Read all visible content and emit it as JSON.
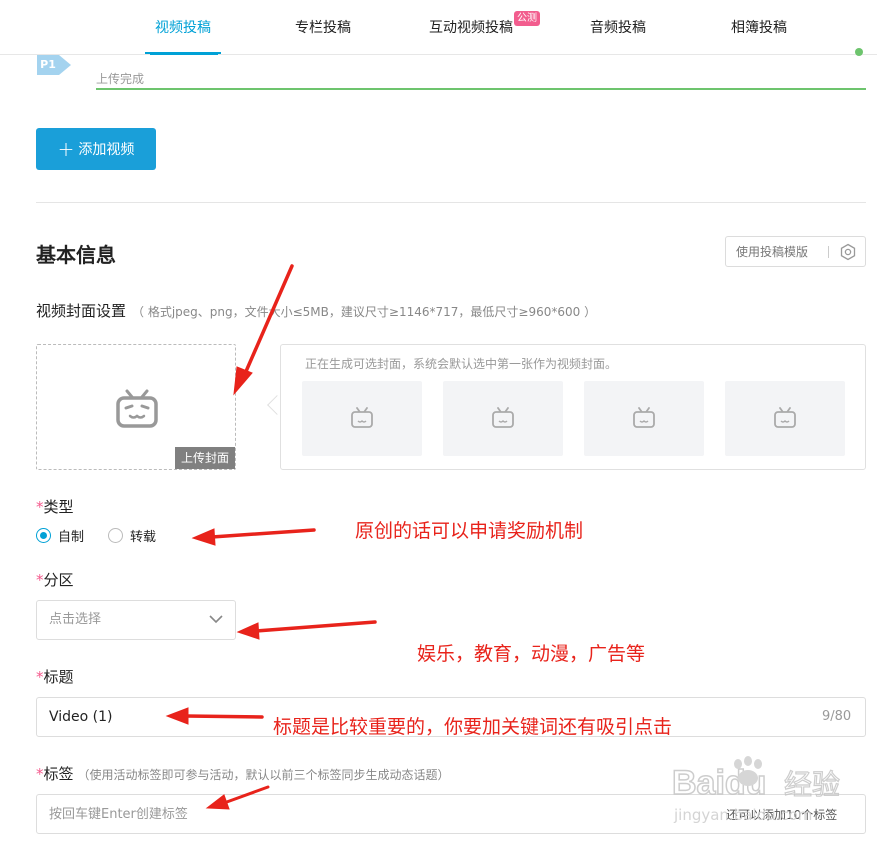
{
  "tabs": [
    {
      "label": "视频投稿",
      "active": true
    },
    {
      "label": "专栏投稿",
      "active": false
    },
    {
      "label": "互动视频投稿",
      "active": false,
      "badge": "公测"
    },
    {
      "label": "音频投稿",
      "active": false
    },
    {
      "label": "相簿投稿",
      "active": false
    }
  ],
  "upload": {
    "part_label": "P1",
    "status_text": "上传完成",
    "progress": 1.0
  },
  "add_video_label": "添加视频",
  "basic_info": {
    "title": "基本信息",
    "template_button": "使用投稿模版"
  },
  "cover": {
    "label": "视频封面设置",
    "hint": "（ 格式jpeg、png，文件大小≤5MB，建议尺寸≥1146*717，最低尺寸≥960*600 ）",
    "upload_label": "上传封面",
    "generating_hint": "正在生成可选封面，系统会默认选中第一张作为视频封面。"
  },
  "type_field": {
    "label": "类型",
    "options": [
      "自制",
      "转载"
    ],
    "selected": "自制"
  },
  "zone_field": {
    "label": "分区",
    "placeholder": "点击选择"
  },
  "title_field": {
    "label": "标题",
    "value": "Video (1)",
    "counter": "9/80"
  },
  "tags_field": {
    "label": "标签",
    "hint": "（使用活动标签即可参与活动，默认以前三个标签同步生成动态话题）",
    "placeholder": "按回车键Enter创建标签",
    "counter": "还可以添加10个标签"
  },
  "annotations": {
    "type_note": "原创的话可以申请奖励机制",
    "zone_note": "娱乐，教育，动漫，广告等",
    "title_note": "标题是比较重要的，你要加关键词还有吸引点击"
  },
  "watermark": {
    "brand": "Baidu",
    "cn": "经验",
    "domain": "jingyan.baidu.com"
  },
  "colors": {
    "accent": "#00a1d6",
    "button": "#1a9fd9",
    "required": "#f45a8d",
    "annotation": "#e8231b",
    "progress": "#6dc46d"
  }
}
